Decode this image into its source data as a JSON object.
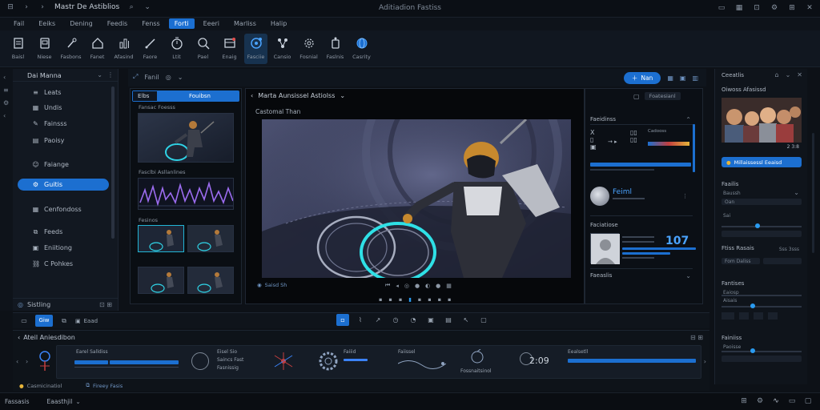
{
  "titlebar": {
    "app_name": "Mastr De Astiblios",
    "window_title": "Aditiadion Fastiss"
  },
  "menu": [
    {
      "label": "Fail",
      "active": false
    },
    {
      "label": "Eeiks",
      "active": false
    },
    {
      "label": "Dening",
      "active": false
    },
    {
      "label": "Feedis",
      "active": false
    },
    {
      "label": "Fenss",
      "active": false
    },
    {
      "label": "Forti",
      "active": true
    },
    {
      "label": "Eeeri",
      "active": false
    },
    {
      "label": "Marliss",
      "active": false
    },
    {
      "label": "Halip",
      "active": false
    }
  ],
  "ribbon": [
    {
      "label": "Baisl",
      "icon": "document-icon"
    },
    {
      "label": "Niese",
      "icon": "file-icon"
    },
    {
      "label": "Fasbons",
      "icon": "brush-icon"
    },
    {
      "label": "Fanet",
      "icon": "home-icon"
    },
    {
      "label": "Afasind",
      "icon": "chart-icon"
    },
    {
      "label": "Faore",
      "icon": "pen-icon"
    },
    {
      "label": "Ltit",
      "icon": "timer-icon"
    },
    {
      "label": "Pael",
      "icon": "search-icon"
    },
    {
      "label": "Enaig",
      "icon": "image-icon"
    },
    {
      "label": "Fasciie",
      "icon": "target-icon",
      "active": true
    },
    {
      "label": "Cansio",
      "icon": "nodes-icon"
    },
    {
      "label": "Fosnial",
      "icon": "settings-icon"
    },
    {
      "label": "Faslnis",
      "icon": "figure-icon"
    },
    {
      "label": "Casrity",
      "icon": "globe-icon"
    }
  ],
  "left_panel": {
    "title": "Dai Manna",
    "items": [
      {
        "label": "Leats",
        "icon": "list-icon",
        "active": false
      },
      {
        "label": "Undis",
        "icon": "grid-icon",
        "active": false
      },
      {
        "label": "Fainsss",
        "icon": "pen-icon",
        "active": false
      },
      {
        "label": "Paoisy",
        "icon": "doc-icon",
        "active": false
      },
      {
        "label": "Faiange",
        "icon": "smile-icon",
        "active": false
      },
      {
        "label": "Guitis",
        "icon": "settings-icon",
        "active": true
      },
      {
        "label": "Cenfondoss",
        "icon": "table-icon",
        "active": false
      },
      {
        "label": "Feeds",
        "icon": "layers-icon",
        "active": false
      },
      {
        "label": "Eniitiong",
        "icon": "bag-icon",
        "active": false
      },
      {
        "label": "C Pohkes",
        "icon": "link-icon",
        "active": false
      }
    ],
    "footer": "Sistling"
  },
  "center_toolbar": {
    "breadcrumb": "Fanil",
    "action_button": "Nan"
  },
  "asset_panel": {
    "tab_a": "Elbs",
    "tab_b": "Fouibsn",
    "section1": "Fansac Foesss",
    "section2": "Fasclbi Asllanlines",
    "section3": "Fesinos"
  },
  "viewport": {
    "title": "Marta Aunsissel Astiolss",
    "subtitle": "Castomal Than",
    "status": "Saisd Sh",
    "tools_right": "Foatesianl"
  },
  "properties": {
    "section1": "Faeidinss",
    "row1_label": "Cadooss",
    "avatar_name": "Feiml",
    "section2": "Faciatiose",
    "stat_value": "107",
    "section3": "Faeaslis"
  },
  "right_panel": {
    "title": "Ceeatlis",
    "preview_title": "Oiwoss Afasissd",
    "preview_time": "2 3:8",
    "action_button": "Millaissessl Eeaisd",
    "s_facilis": "Faailis",
    "s_facilis_sub": "Baussh",
    "s_field1": "Oan",
    "s_small": "Sai",
    "s_range": "Ftiss Rasais",
    "s_fieldr": "Fom Daliss",
    "s_fieldr_val": "Sss 3sss",
    "s_stats": "Fantises",
    "s_sub": "Eaiosp",
    "s_sub2": "Aisais",
    "s_fainiss": "Fainiiss",
    "s_last": "Paoisse"
  },
  "timeline_toolbar": {
    "view_button": "Giw",
    "label": "Eaad"
  },
  "timeline": {
    "title": "Ateil Aniesdibon",
    "keyframes": [
      {
        "label": "Earel Salldiss"
      },
      {
        "label": "Eisel Sio"
      },
      {
        "label": "Saincs Fast"
      },
      {
        "label": "Fasnissig"
      },
      {
        "label": "Faiiid"
      },
      {
        "label": "Faiissel"
      },
      {
        "label": "Fossnaitsinol"
      },
      {
        "label": "2:09"
      },
      {
        "label": "Eealsetll"
      }
    ],
    "footer_left": "Casmicinatiol",
    "footer_right": "Fireey Fasis"
  },
  "statusbar": {
    "left": "Fassasis",
    "mid": "Eaasthjil"
  },
  "colors": {
    "accent": "#1c6fd0",
    "cyan": "#21b5d6",
    "bg": "#0d1117",
    "panel": "#121821"
  }
}
